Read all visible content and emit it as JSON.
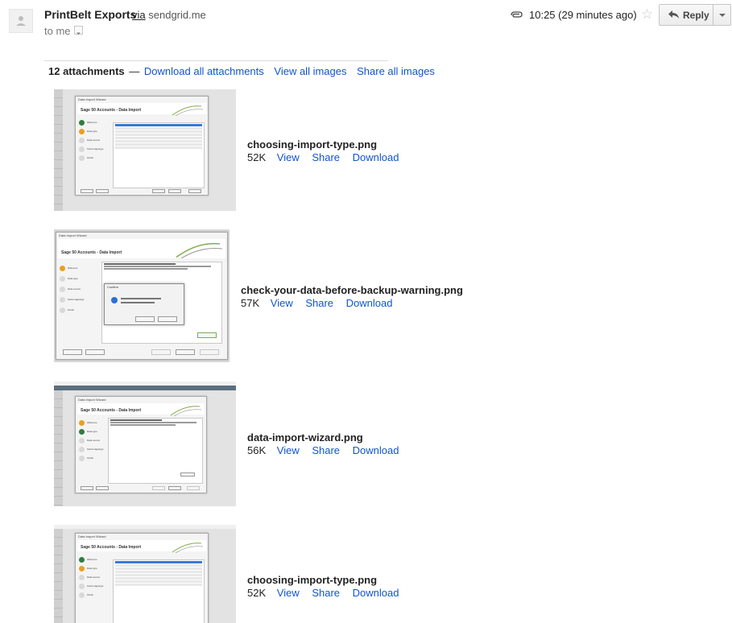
{
  "sender": {
    "name": "PrintBelt Exports",
    "via_word": "via",
    "via_domain": "sendgrid.me"
  },
  "recipient": {
    "label": "to me"
  },
  "header": {
    "time": "10:25 (29 minutes ago)",
    "reply_label": "Reply",
    "star_icon": "star-icon",
    "attachment_icon": "paperclip-icon"
  },
  "attachments_bar": {
    "count": "12 attachments",
    "separator": "—",
    "download_all": "Download all attachments",
    "view_all": "View all images",
    "share_all": "Share all images"
  },
  "attachments": [
    {
      "filename": "choosing-import-type.png",
      "size": "52K",
      "view": "View",
      "share": "Share",
      "download": "Download"
    },
    {
      "filename": "check-your-data-before-backup-warning.png",
      "size": "57K",
      "view": "View",
      "share": "Share",
      "download": "Download"
    },
    {
      "filename": "data-import-wizard.png",
      "size": "56K",
      "view": "View",
      "share": "Share",
      "download": "Download"
    },
    {
      "filename": "choosing-import-type.png",
      "size": "52K",
      "view": "View",
      "share": "Share",
      "download": "Download"
    }
  ],
  "thumbnails": {
    "window_title": "Data Import Wizard",
    "header_text": "Sage 50 Accounts - Data Import",
    "dialog_title": "Confirm"
  },
  "colors": {
    "link": "#1155cc",
    "text": "#222222",
    "muted": "#777777"
  }
}
